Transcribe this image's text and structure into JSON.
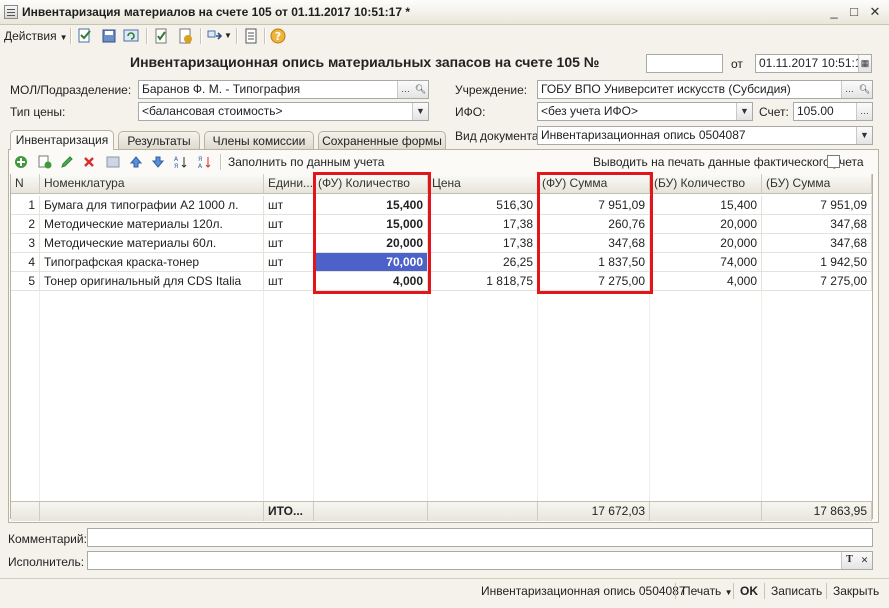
{
  "window": {
    "title": "Инвентаризация материалов на счете 105  от 01.11.2017 10:51:17 *",
    "controls": [
      "_",
      "□",
      "✕"
    ]
  },
  "toolbar": {
    "actions_label": "Действия"
  },
  "header": {
    "doc_title": "Инвентаризационная опись материальных запасов на счете 105 №",
    "number_value": "",
    "date_label": "от",
    "date_value": "01.11.2017 10:51:17",
    "mol_label": "МОЛ/Подразделение:",
    "mol_value": "Баранов Ф. М. - Типография",
    "price_type_label": "Тип цены:",
    "price_type_value": "<балансовая стоимость>",
    "org_label": "Учреждение:",
    "org_value": "ГОБУ ВПО Университет искусств (Субсидия)",
    "ifo_label": "ИФО:",
    "ifo_value": "<без учета ИФО>",
    "account_label": "Счет:",
    "account_value": "105.00",
    "doc_type_label": "Вид документа:",
    "doc_type_value": "Инвентаризационная опись 0504087"
  },
  "tabs": [
    "Инвентаризация",
    "Результаты",
    "Члены комиссии",
    "Сохраненные формы"
  ],
  "table_toolbar": {
    "fill_label": "Заполнить по данным учета",
    "print_label": "Выводить на печать данные фактического учета"
  },
  "table": {
    "columns": [
      "N",
      "Номенклатура",
      "Едини...",
      "(ФУ) Количество",
      "Цена",
      "(ФУ) Сумма",
      "(БУ) Количество",
      "(БУ) Сумма"
    ],
    "rows": [
      [
        "1",
        "Бумага для типографии А2 1000 л.",
        "шт",
        "15,400",
        "516,30",
        "7 951,09",
        "15,400",
        "7 951,09"
      ],
      [
        "2",
        "Методические материалы 120л.",
        "шт",
        "15,000",
        "17,38",
        "260,76",
        "20,000",
        "347,68"
      ],
      [
        "3",
        "Методические материалы 60л.",
        "шт",
        "20,000",
        "17,38",
        "347,68",
        "20,000",
        "347,68"
      ],
      [
        "4",
        "Типографская краска-тонер",
        "шт",
        "70,000",
        "26,25",
        "1 837,50",
        "74,000",
        "1 942,50"
      ],
      [
        "5",
        "Тонер оригинальный для CDS Italia",
        "шт",
        "4,000",
        "1 818,75",
        "7 275,00",
        "4,000",
        "7 275,00"
      ]
    ],
    "footer": {
      "label": "ИТО...",
      "fu_sum": "17 672,03",
      "bu_sum": "17 863,95"
    }
  },
  "bottom": {
    "comment_label": "Комментарий:",
    "comment_value": "",
    "executor_label": "Исполнитель:",
    "executor_value": ""
  },
  "statusbar": {
    "form_name": "Инвентаризационная опись 0504087",
    "print_label": "Печать",
    "ok_label": "OK",
    "save_label": "Записать",
    "close_label": "Закрыть"
  },
  "colors": {
    "highlight": "#e3151b",
    "selection": "#4d62c8"
  }
}
